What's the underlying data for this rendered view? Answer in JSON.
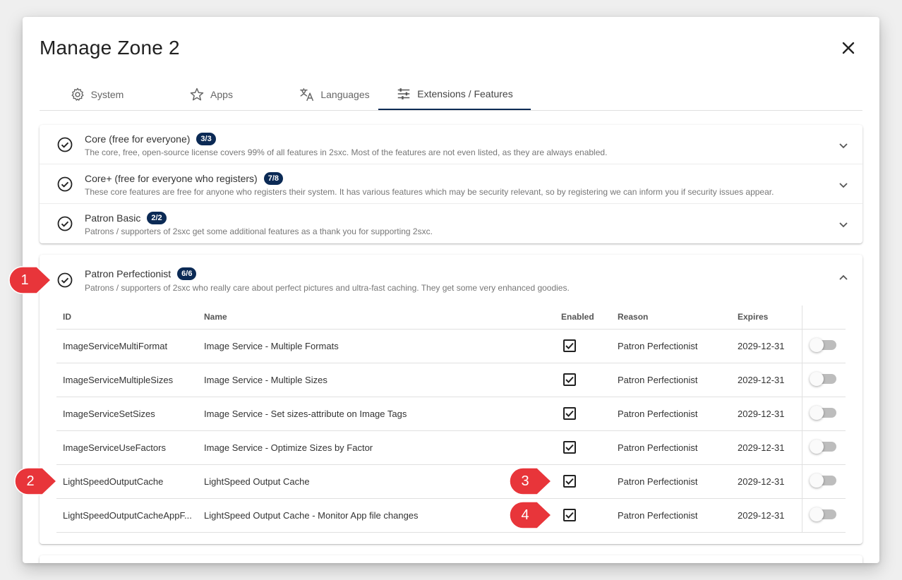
{
  "dialog": {
    "title": "Manage Zone 2",
    "close_icon": "close-icon"
  },
  "tabs": [
    {
      "label": "System",
      "icon": "gear-icon"
    },
    {
      "label": "Apps",
      "icon": "star-icon"
    },
    {
      "label": "Languages",
      "icon": "translate-icon"
    },
    {
      "label": "Extensions / Features",
      "icon": "tune-icon",
      "active": true
    }
  ],
  "licenses": [
    {
      "title": "Core (free for everyone)",
      "badge": "3/3",
      "description": "The core, free, open-source license covers 99% of all features in 2sxc. Most of the features are not even listed, as they are always enabled."
    },
    {
      "title": "Core+ (free for everyone who registers)",
      "badge": "7/8",
      "description": "These core features are free for anyone who registers their system. It has various features which may be security relevant, so by registering we can inform you if security issues appear."
    },
    {
      "title": "Patron Basic",
      "badge": "2/2",
      "description": "Patrons / supporters of 2sxc get some additional features as a thank you for supporting 2sxc."
    }
  ],
  "expanded": {
    "title": "Patron Perfectionist",
    "badge": "6/6",
    "description": "Patrons / supporters of 2sxc who really care about perfect pictures and ultra-fast caching. They get some very enhanced goodies."
  },
  "table": {
    "headers": {
      "id": "ID",
      "name": "Name",
      "enabled": "Enabled",
      "reason": "Reason",
      "expires": "Expires"
    },
    "rows": [
      {
        "id": "ImageServiceMultiFormat",
        "name": "Image Service - Multiple Formats",
        "enabled": true,
        "reason": "Patron Perfectionist",
        "expires": "2029-12-31"
      },
      {
        "id": "ImageServiceMultipleSizes",
        "name": "Image Service - Multiple Sizes",
        "enabled": true,
        "reason": "Patron Perfectionist",
        "expires": "2029-12-31"
      },
      {
        "id": "ImageServiceSetSizes",
        "name": "Image Service - Set sizes-attribute on Image Tags",
        "enabled": true,
        "reason": "Patron Perfectionist",
        "expires": "2029-12-31"
      },
      {
        "id": "ImageServiceUseFactors",
        "name": "Image Service - Optimize Sizes by Factor",
        "enabled": true,
        "reason": "Patron Perfectionist",
        "expires": "2029-12-31"
      },
      {
        "id": "LightSpeedOutputCache",
        "name": "LightSpeed Output Cache",
        "enabled": true,
        "reason": "Patron Perfectionist",
        "expires": "2029-12-31"
      },
      {
        "id": "LightSpeedOutputCacheAppF...",
        "name": "LightSpeed Output Cache - Monitor App file changes",
        "enabled": true,
        "reason": "Patron Perfectionist",
        "expires": "2029-12-31"
      }
    ]
  },
  "callouts": [
    "1",
    "2",
    "3",
    "4"
  ],
  "colors": {
    "accent": "#0b2a55",
    "callout": "#e8353a"
  }
}
